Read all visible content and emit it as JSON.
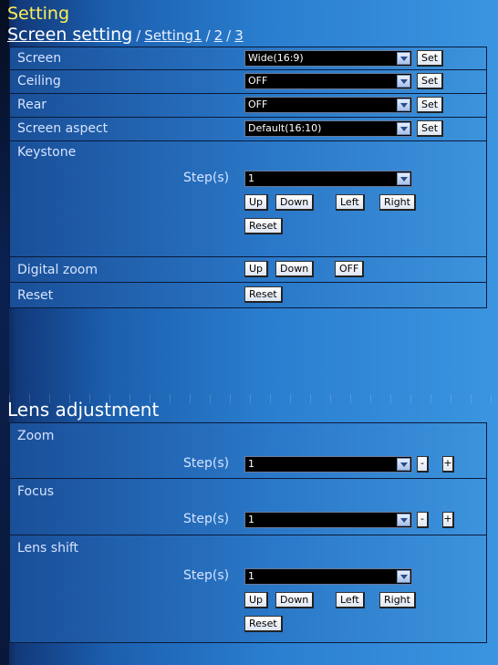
{
  "header": {
    "title": "Setting",
    "breadcrumb": {
      "current": "Screen setting",
      "separator": "/",
      "links": [
        "Setting1",
        "2",
        "3"
      ]
    }
  },
  "screen_setting": {
    "screen": {
      "label": "Screen",
      "value": "Wide(16:9)",
      "button": "Set"
    },
    "ceiling": {
      "label": "Ceiling",
      "value": "OFF",
      "button": "Set"
    },
    "rear": {
      "label": "Rear",
      "value": "OFF",
      "button": "Set"
    },
    "screen_aspect": {
      "label": "Screen aspect",
      "value": "Default(16:10)",
      "button": "Set"
    },
    "keystone": {
      "label": "Keystone",
      "step_label": "Step(s)",
      "step_value": "1",
      "buttons": {
        "up": "Up",
        "down": "Down",
        "left": "Left",
        "right": "Right",
        "reset": "Reset"
      }
    },
    "digital_zoom": {
      "label": "Digital zoom",
      "up": "Up",
      "down": "Down",
      "off": "OFF"
    },
    "reset": {
      "label": "Reset",
      "button": "Reset"
    }
  },
  "lens_adjustment": {
    "title": "Lens adjustment",
    "zoom": {
      "label": "Zoom",
      "step_label": "Step(s)",
      "step_value": "1",
      "minus": "-",
      "plus": "+"
    },
    "focus": {
      "label": "Focus",
      "step_label": "Step(s)",
      "step_value": "1",
      "minus": "-",
      "plus": "+"
    },
    "lens_shift": {
      "label": "Lens shift",
      "step_label": "Step(s)",
      "step_value": "1",
      "buttons": {
        "up": "Up",
        "down": "Down",
        "left": "Left",
        "right": "Right",
        "reset": "Reset"
      }
    }
  },
  "colors": {
    "title": "#ffee55",
    "select_bg": "#000000",
    "row_gradient_start": "#1a4f98",
    "row_gradient_end": "#3d93dc"
  }
}
